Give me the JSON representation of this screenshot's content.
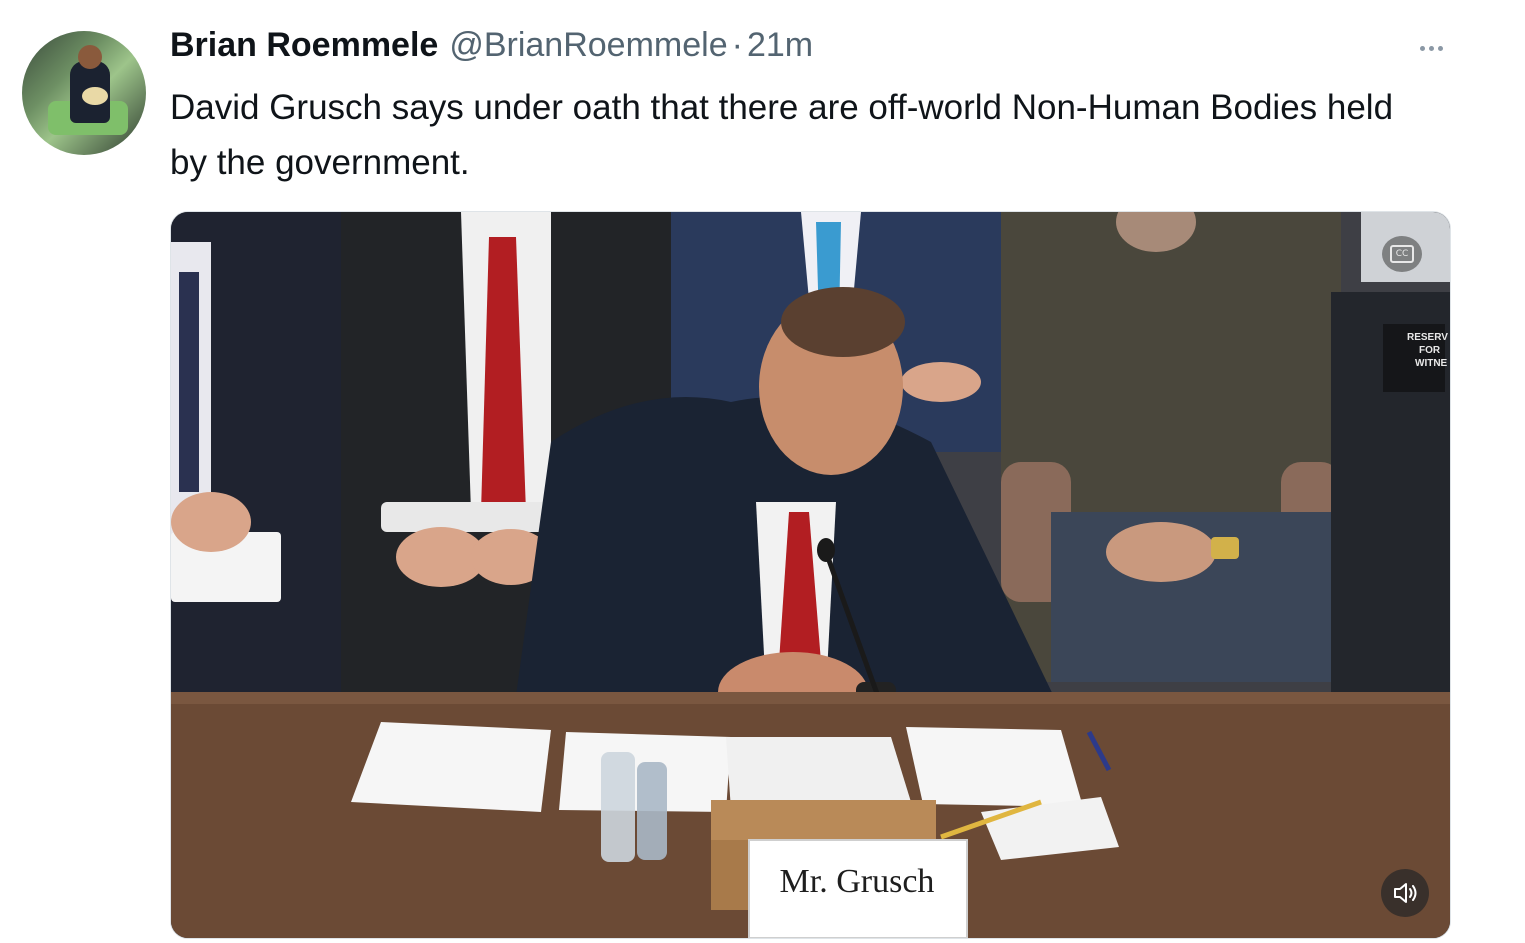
{
  "tweet": {
    "author": {
      "display_name": "Brian Roemmele",
      "handle": "@BrianRoemmele",
      "separator": "·",
      "time": "21m",
      "avatar_icon": "profile-avatar"
    },
    "text": "David Grusch says under oath that there are off-world Non-Human Bodies held by the government.",
    "more_icon": "ellipsis-icon",
    "media": {
      "type": "video",
      "nameplate": "Mr. Grusch",
      "reserved_sign": [
        "RESERV",
        "FOR",
        "WITNE"
      ],
      "captions_icon": "closed-captions-icon",
      "volume_icon": "speaker-icon",
      "colors": {
        "table": "#6b4a35",
        "tie": "#b21e22",
        "suit": "#1a2333"
      }
    }
  }
}
